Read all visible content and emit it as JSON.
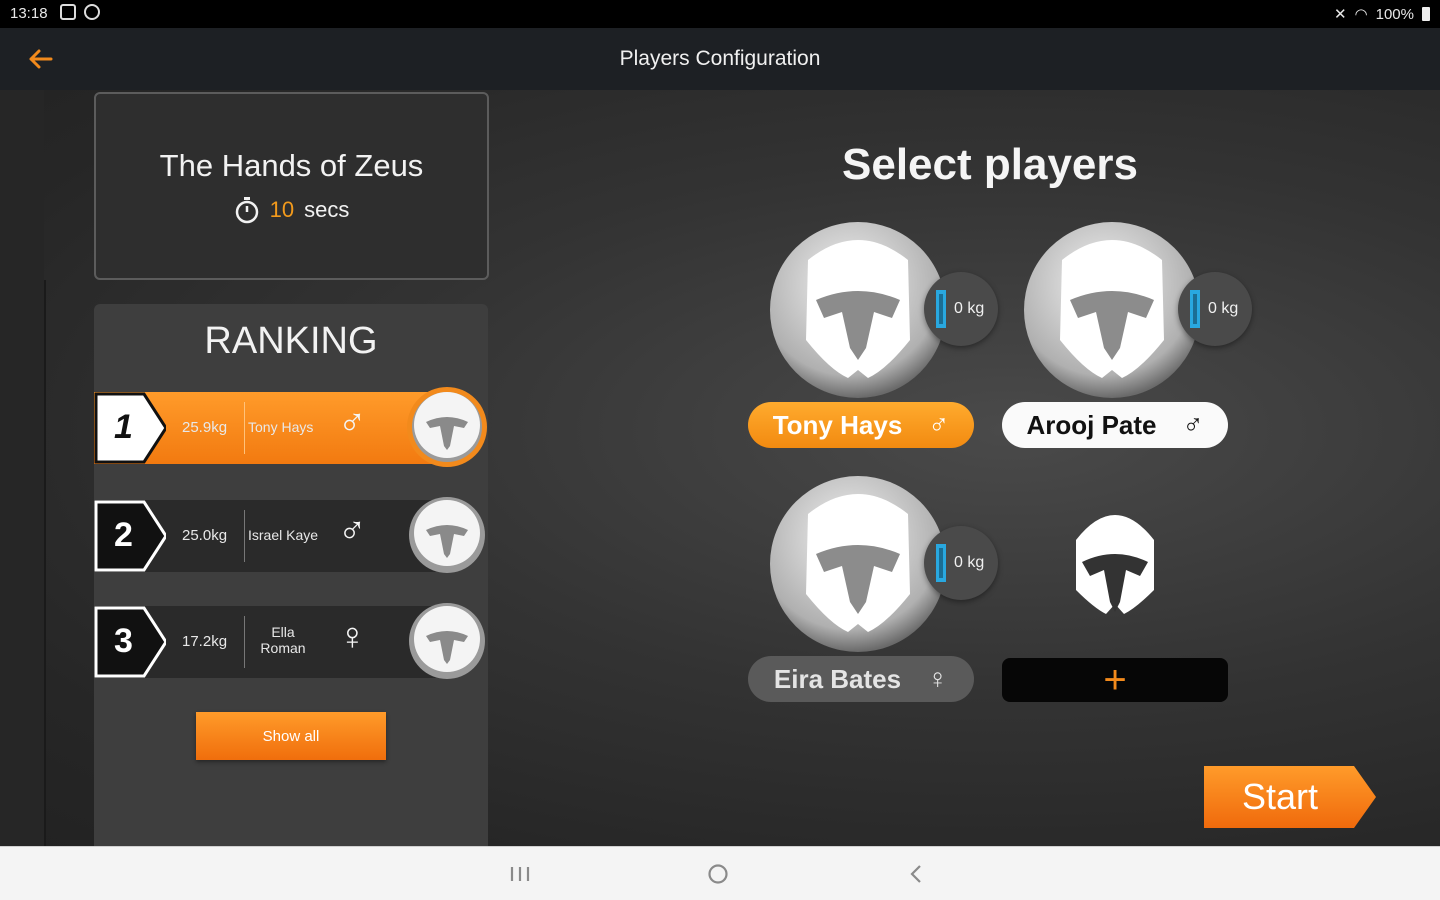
{
  "status_bar": {
    "time": "13:18",
    "battery": "100%"
  },
  "app_bar": {
    "title": "Players Configuration"
  },
  "game": {
    "title": "The Hands of Zeus",
    "time_value": "10",
    "time_unit": "secs"
  },
  "ranking": {
    "title": "RANKING",
    "rows": [
      {
        "rank": "1",
        "weight": "25.9kg",
        "name": "Tony Hays",
        "gender": "♂"
      },
      {
        "rank": "2",
        "weight": "25.0kg",
        "name": "Israel Kaye",
        "gender": "♂"
      },
      {
        "rank": "3",
        "weight": "17.2kg",
        "name": "Ella Roman",
        "gender": "♀"
      }
    ],
    "show_all_label": "Show all"
  },
  "select": {
    "title": "Select players",
    "players": [
      {
        "name": "Tony Hays",
        "gender": "♂",
        "weight": "0 kg",
        "selected": true
      },
      {
        "name": "Arooj Pate",
        "gender": "♂",
        "weight": "0 kg",
        "selected": false
      },
      {
        "name": "Eira Bates",
        "gender": "♀",
        "weight": "0 kg",
        "selected": false
      }
    ],
    "add_label": "+",
    "start_label": "Start"
  },
  "colors": {
    "accent": "#f28a1c",
    "gauge": "#29a8e0"
  }
}
